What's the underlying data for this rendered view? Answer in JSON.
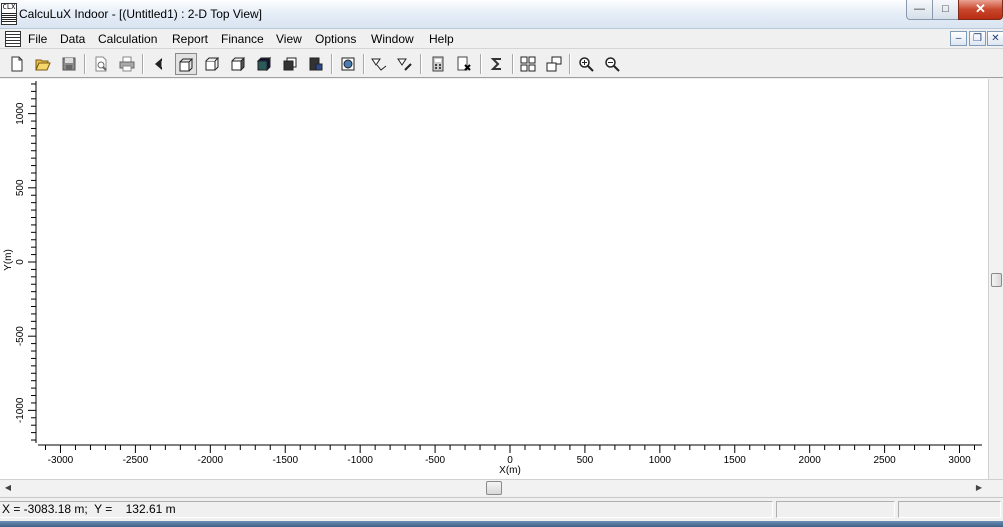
{
  "window": {
    "title": "CalcuLuX Indoor - [(Untitled1)  : 2-D Top View]",
    "icon_text": "CLX",
    "controls": {
      "minimize": "—",
      "maximize": "□",
      "close": "✕"
    }
  },
  "menu": {
    "items": [
      "File",
      "Data",
      "Calculation",
      "Report",
      "Finance",
      "View",
      "Options",
      "Window",
      "Help"
    ],
    "mdi_controls": {
      "minimize": "–",
      "restore": "❐",
      "close": "✕"
    }
  },
  "toolbar": {
    "buttons": [
      {
        "name": "new-document-icon"
      },
      {
        "name": "open-folder-icon"
      },
      {
        "name": "save-icon"
      },
      {
        "name": "print-preview-icon"
      },
      {
        "name": "print-icon"
      },
      {
        "name": "back-view-icon"
      },
      {
        "name": "view-top-cube-icon",
        "pressed": true
      },
      {
        "name": "view-front-cube-icon"
      },
      {
        "name": "view-side-cube-icon"
      },
      {
        "name": "view-solid-cube-icon"
      },
      {
        "name": "view-stack-cube-icon"
      },
      {
        "name": "view-save-cube-icon"
      },
      {
        "name": "globe-icon"
      },
      {
        "name": "luminaire-icon"
      },
      {
        "name": "luminaire-edit-icon"
      },
      {
        "name": "calculator-icon"
      },
      {
        "name": "delete-calculation-icon"
      },
      {
        "name": "sum-icon"
      },
      {
        "name": "tile-windows-icon"
      },
      {
        "name": "cascade-windows-icon"
      },
      {
        "name": "zoom-in-icon"
      },
      {
        "name": "zoom-out-icon"
      }
    ]
  },
  "plot": {
    "x_axis": {
      "label": "X(m)",
      "ticks": [
        -3000,
        -2500,
        -2000,
        -1500,
        -1000,
        -500,
        0,
        500,
        1000,
        1500,
        2000,
        2500,
        3000
      ],
      "range": [
        -3150,
        3150
      ]
    },
    "y_axis": {
      "label": "Y(m)",
      "ticks": [
        1000,
        500,
        0,
        -500,
        -1000
      ],
      "range": [
        -1220,
        1220
      ]
    }
  },
  "status": {
    "coordinates": "X = -3083.18 m;  Y =    132.61 m",
    "pane2": "",
    "pane3": ""
  }
}
